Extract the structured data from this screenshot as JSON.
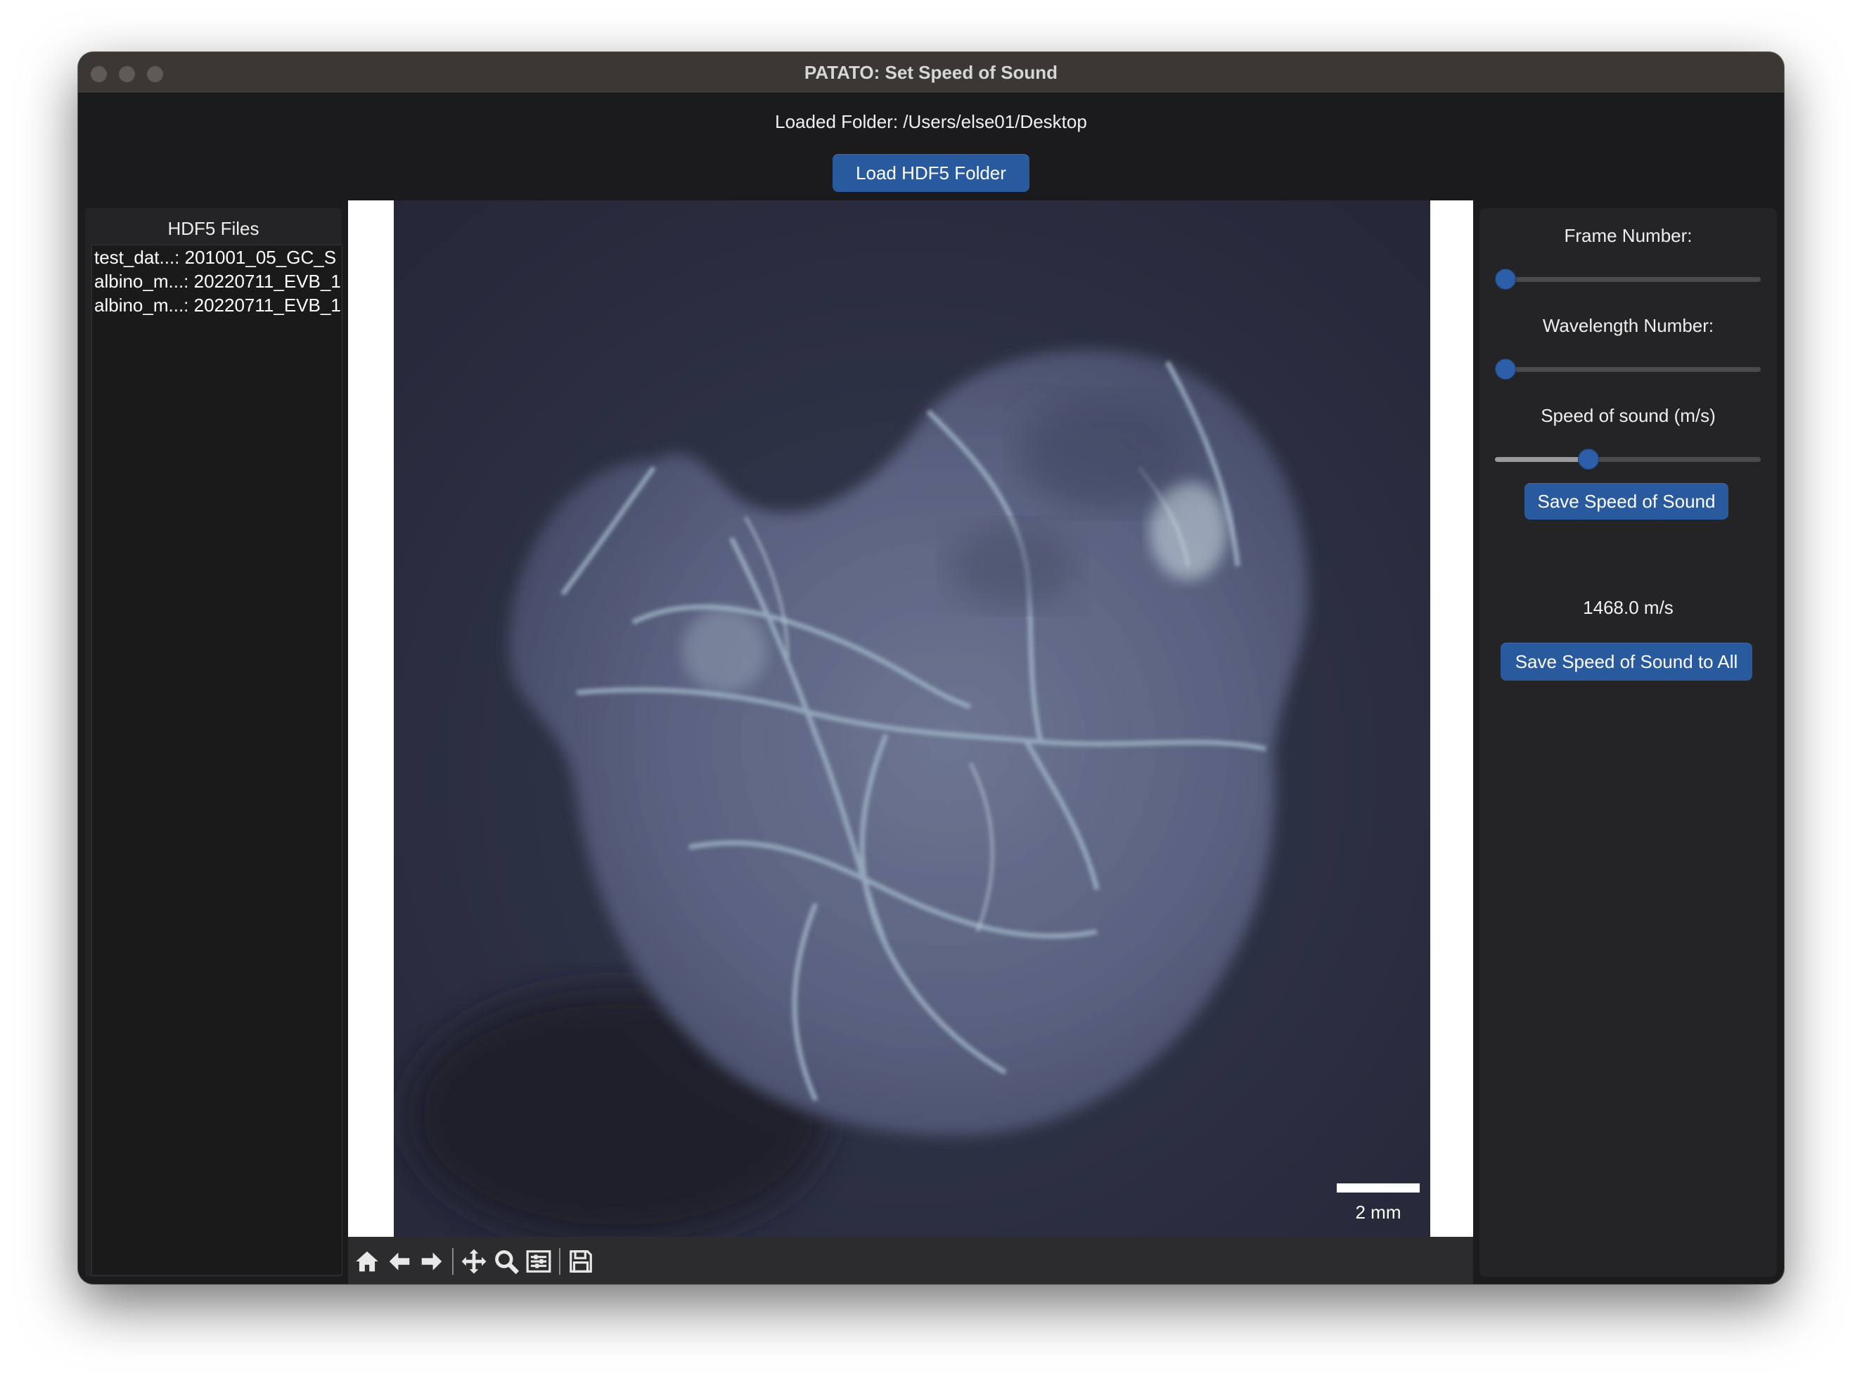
{
  "window": {
    "title": "PATATO: Set Speed of Sound"
  },
  "header": {
    "folder_label": "Loaded Folder: /Users/else01/Desktop",
    "load_button": "Load HDF5 Folder"
  },
  "file_panel": {
    "title": "HDF5 Files",
    "files": [
      "test_dat...: 201001_05_GC_S",
      "albino_m...: 20220711_EVB_1",
      "albino_m...: 20220711_EVB_1"
    ]
  },
  "figure": {
    "scale_bar_label": "2 mm",
    "colormap": "bone"
  },
  "toolbar": {
    "tools": [
      "home-icon",
      "back-arrow-icon",
      "forward-arrow-icon",
      "pan-icon",
      "zoom-icon",
      "configure-subplots-icon",
      "save-icon"
    ]
  },
  "controls": {
    "frame_label": "Frame Number:",
    "frame_value_fraction": 0.0,
    "wavelength_label": "Wavelength Number:",
    "wavelength_value_fraction": 0.0,
    "speed_label": "Speed of sound (m/s)",
    "speed_value_fraction": 0.34,
    "save_button": "Save Speed of Sound",
    "speed_readout": "1468.0 m/s",
    "save_all_button": "Save Speed of Sound to All"
  },
  "colors": {
    "accent": "#2a5a9e",
    "window_bg": "#1b1b1d",
    "panel_bg": "#242426"
  }
}
